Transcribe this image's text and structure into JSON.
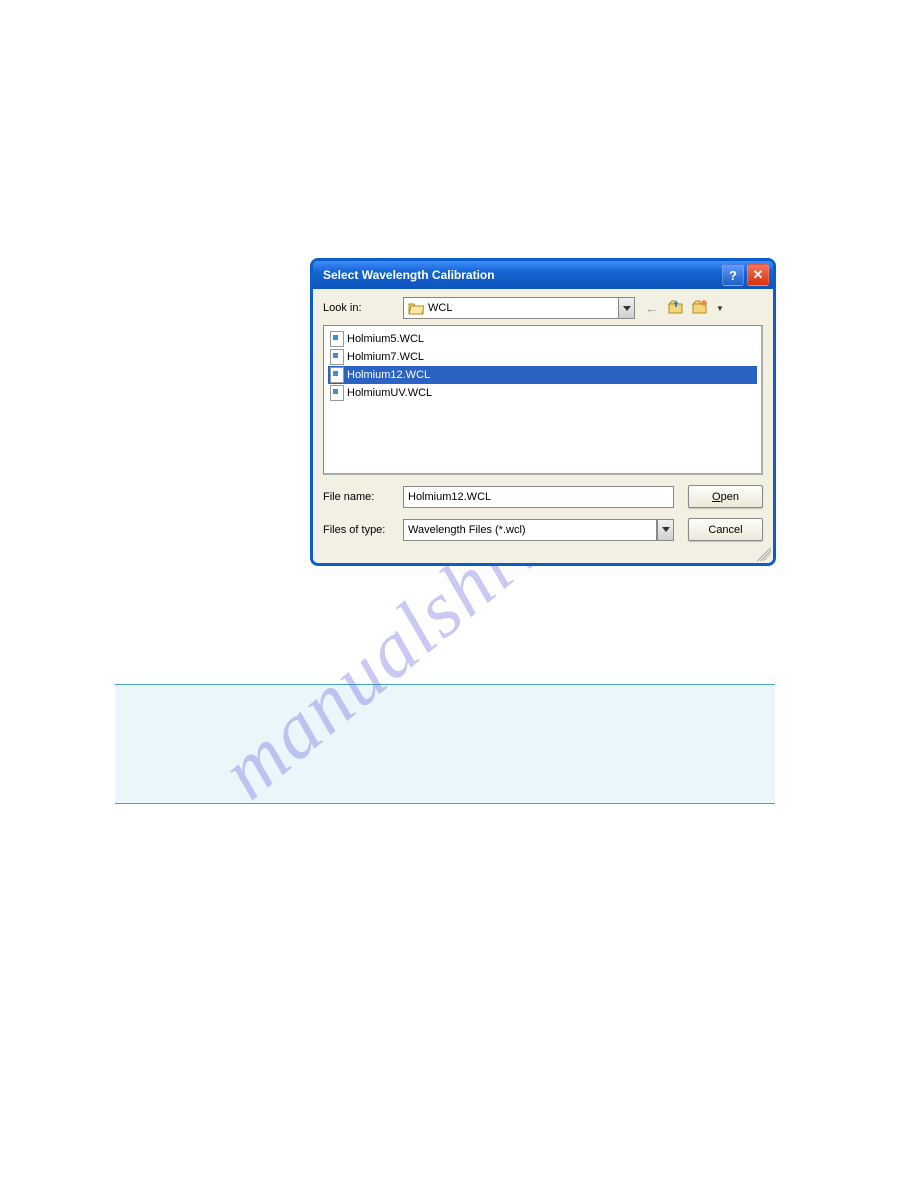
{
  "watermark": "manualshive.com",
  "dialog": {
    "title": "Select Wavelength Calibration",
    "look_in_label": "Look in:",
    "look_in_value": "WCL",
    "files": [
      {
        "name": "Holmium5.WCL",
        "selected": false
      },
      {
        "name": "Holmium7.WCL",
        "selected": false
      },
      {
        "name": "Holmium12.WCL",
        "selected": true
      },
      {
        "name": "HolmiumUV.WCL",
        "selected": false
      }
    ],
    "file_name_label": "File name:",
    "file_name_value": "Holmium12.WCL",
    "files_of_type_label": "Files of type:",
    "files_of_type_value": "Wavelength Files (*.wcl)",
    "open_label": "Open",
    "cancel_label": "Cancel"
  }
}
